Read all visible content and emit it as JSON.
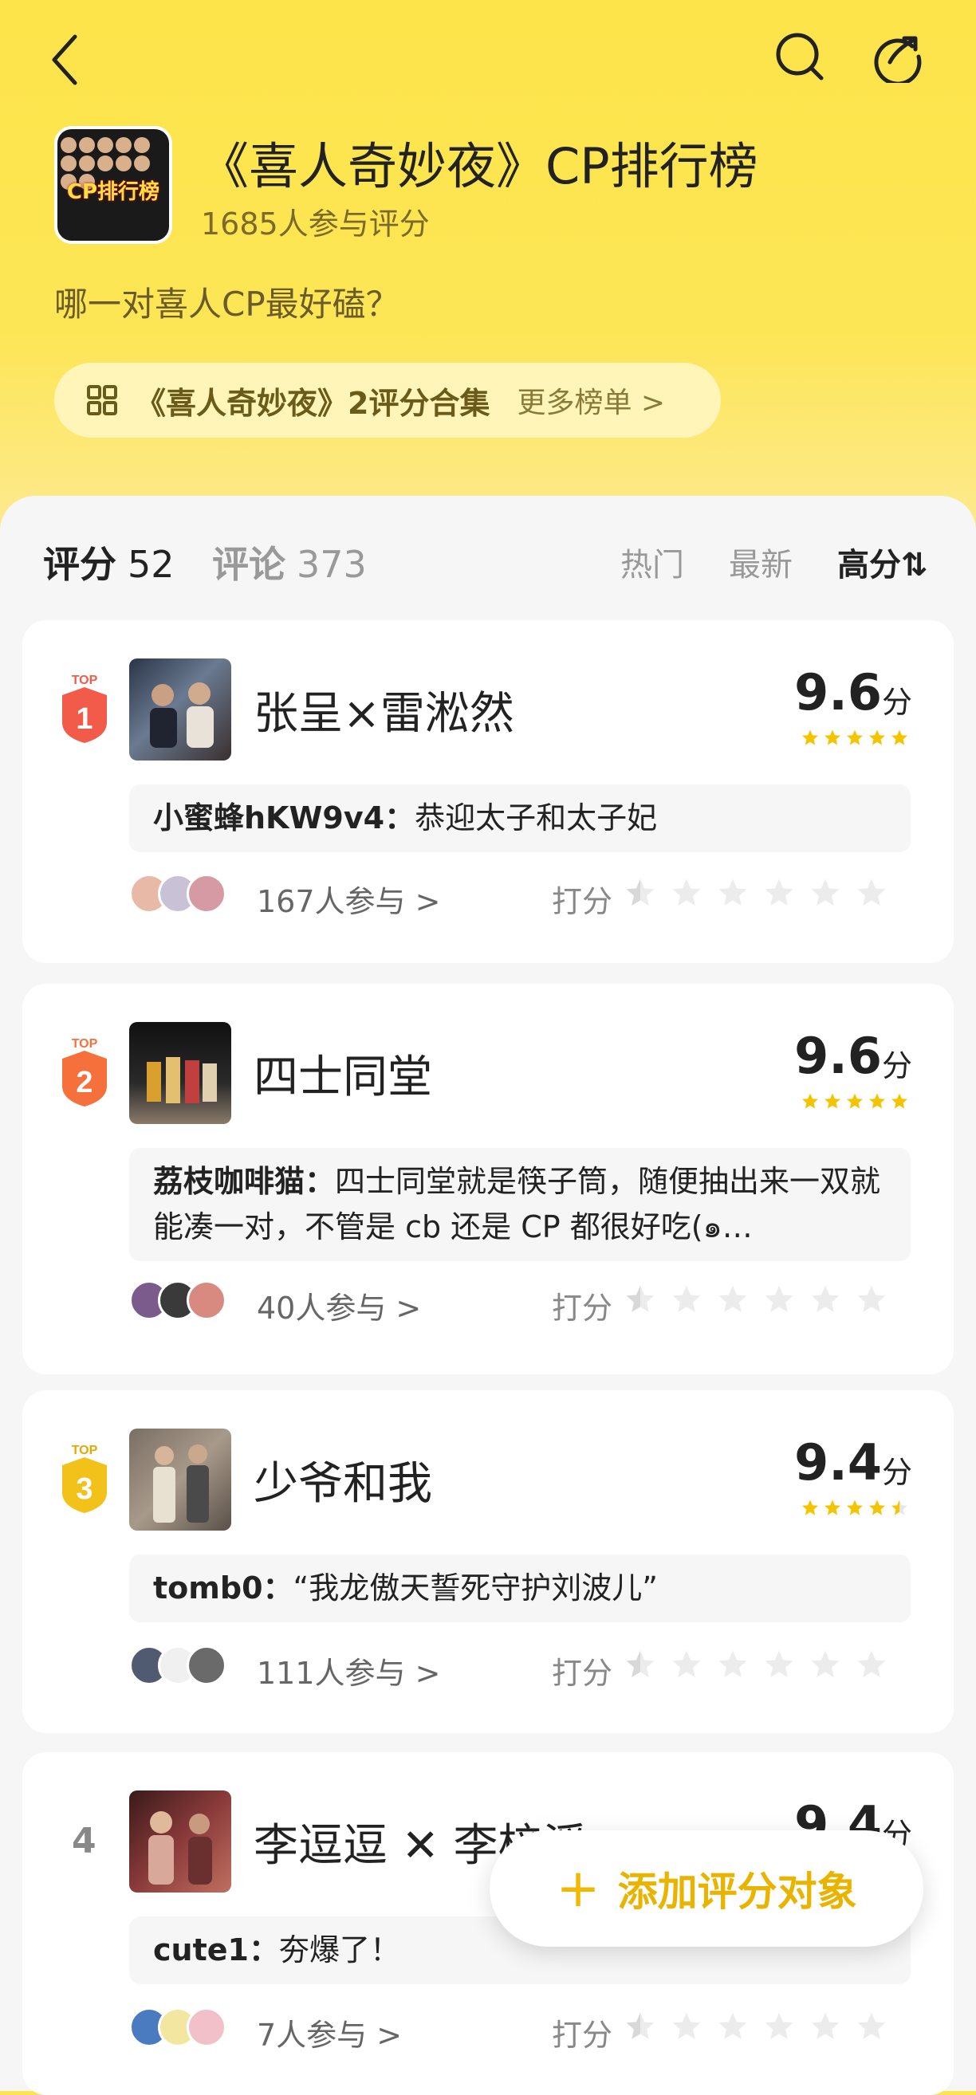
{
  "header": {
    "title": "《喜人奇妙夜》CP排行榜",
    "participants": "1685人参与评分",
    "question": "哪一对喜人CP最好磕？",
    "cover_text": "CP排行榜",
    "collection_label": "《喜人奇妙夜》2评分合集",
    "collection_more": "更多榜单 >"
  },
  "tabs": {
    "score_label": "评分",
    "score_count": "52",
    "comment_label": "评论",
    "comment_count": "373",
    "sort_hot": "热门",
    "sort_new": "最新",
    "sort_high": "高分⇅"
  },
  "rate_label": "打分",
  "score_unit": "分",
  "items": [
    {
      "rank_badge": "TOP",
      "rank": "1",
      "badge_color": "#f25a4a",
      "name": "张呈×雷淞然",
      "score": "9.6",
      "stars": 5,
      "comment_user": "小蜜蜂hKW9v4：",
      "comment_text": "恭迎太子和太子妃",
      "participants": "167人参与 >"
    },
    {
      "rank_badge": "TOP",
      "rank": "2",
      "badge_color": "#f5703a",
      "name": "四士同堂",
      "score": "9.6",
      "stars": 5,
      "comment_user": "荔枝咖啡猫：",
      "comment_text": "四士同堂就是筷子筒，随便抽出来一双就能凑一对，不管是 cb 还是 CP 都很好吃(๑…",
      "participants": "40人参与 >"
    },
    {
      "rank_badge": "TOP",
      "rank": "3",
      "badge_color": "#f2c21a",
      "name": "少爷和我",
      "score": "9.4",
      "stars": 4.5,
      "comment_user": "tomb0：",
      "comment_text": "“我龙傲天誓死守护刘波儿”",
      "participants": "111人参与 >"
    },
    {
      "rank": "4",
      "name": "李逗逗 ✕ 李梓溪",
      "score": "9.4",
      "comment_user": "cute1：",
      "comment_text": "夯爆了！",
      "participants": "7人参与 >"
    }
  ],
  "fab": {
    "plus": "+",
    "label": "添加评分对象"
  }
}
